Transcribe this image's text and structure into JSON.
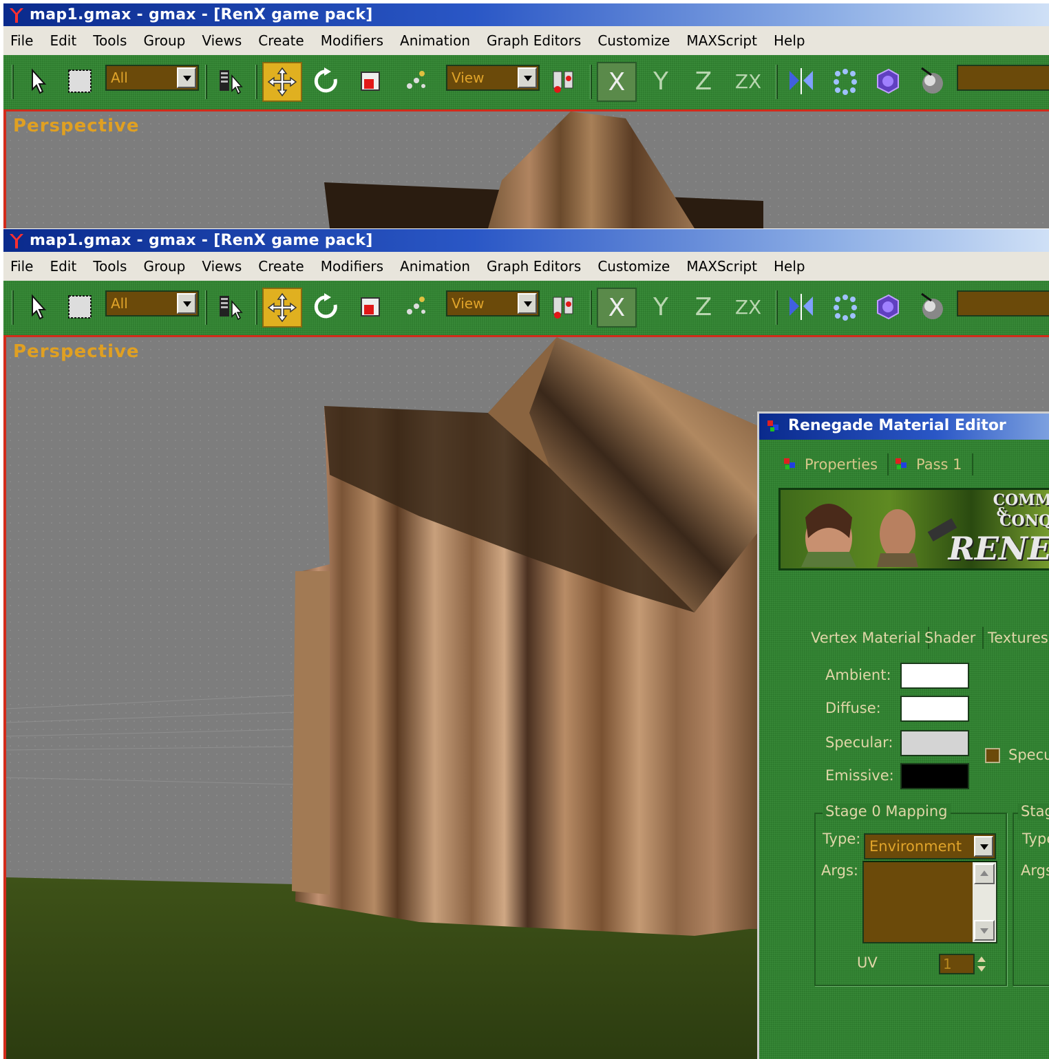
{
  "window": {
    "title": "map1.gmax - gmax - [RenX game pack]"
  },
  "menu": [
    "File",
    "Edit",
    "Tools",
    "Group",
    "Views",
    "Create",
    "Modifiers",
    "Animation",
    "Graph Editors",
    "Customize",
    "MAXScript",
    "Help"
  ],
  "toolbar": {
    "selection_filter": "All",
    "reference_coord": "View",
    "axes": [
      "X",
      "Y",
      "Z",
      "ZX"
    ],
    "active_axis": "X",
    "icons": [
      "select-arrow-icon",
      "region-select-icon",
      "select-by-name-icon",
      "move-icon",
      "rotate-icon",
      "scale-icon",
      "pivot-icon",
      "mirror-icon",
      "array-icon",
      "material-editor-icon",
      "render-icon"
    ]
  },
  "viewport": {
    "label": "Perspective"
  },
  "material_editor": {
    "title": "Renegade Material Editor",
    "tabs": [
      "Properties",
      "Pass 1"
    ],
    "banner_text": [
      "COMM",
      "&",
      "CONQ",
      "RENE"
    ],
    "sub_tabs": [
      "Vertex Material",
      "Shader",
      "Textures"
    ],
    "properties": [
      {
        "label": "Ambient:",
        "color": "#ffffff"
      },
      {
        "label": "Diffuse:",
        "color": "#ffffff"
      },
      {
        "label": "Specular:",
        "color": "#d4d4d4"
      },
      {
        "label": "Emissive:",
        "color": "#000000"
      }
    ],
    "specular_check_label": "Specu",
    "stage0": {
      "title": "Stage 0 Mapping",
      "type_label": "Type:",
      "type_value": "Environment",
      "args_label": "Args:",
      "uv_label": "UV",
      "uv_value": "1"
    },
    "stage1": {
      "title": "Stag",
      "type_label": "Type",
      "args_label": "Args:"
    }
  },
  "colors": {
    "toolbar_green": "#2f7d2f",
    "viewport_border": "#d22b1a",
    "viewport_label": "#e0a022",
    "field_brown": "#6b4a0a"
  }
}
